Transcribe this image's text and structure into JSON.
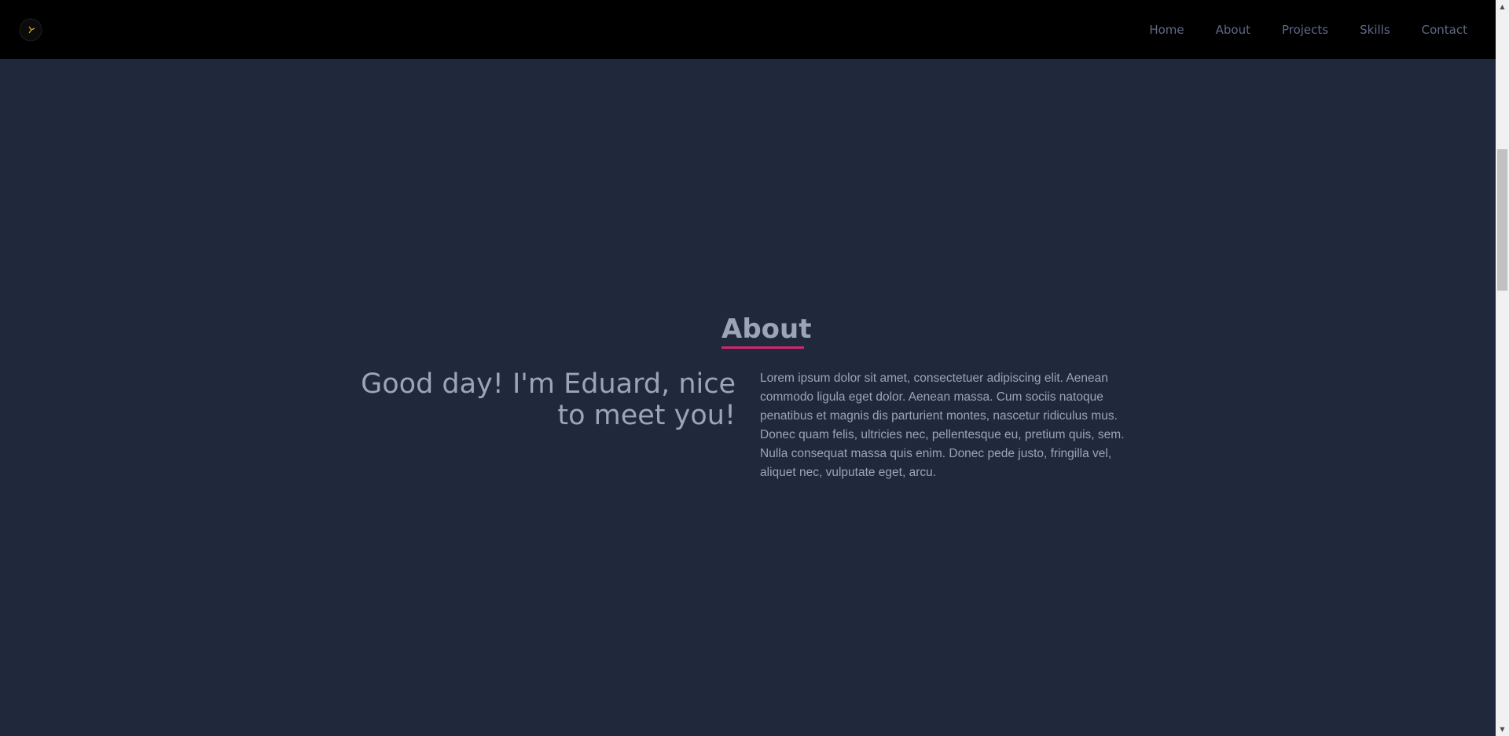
{
  "navbar": {
    "logo_icon": "moon-logo-icon",
    "links": [
      "Home",
      "About",
      "Projects",
      "Skills",
      "Contact"
    ]
  },
  "about": {
    "title": "About",
    "greeting": "Good day! I'm Eduard, nice to meet you!",
    "bio": "Lorem ipsum dolor sit amet, consectetuer adipiscing elit. Aenean commodo ligula eget dolor. Aenean massa. Cum sociis natoque penatibus et magnis dis parturient montes, nascetur ridiculus mus. Donec quam felis, ultricies nec, pellentesque eu, pretium quis, sem. Nulla consequat massa quis enim. Donec pede justo, fringilla vel, aliquet nec, vulputate eget, arcu."
  },
  "colors": {
    "background": "#20283b",
    "navbar": "#000000",
    "nav_text": "#5e6a86",
    "text": "#9aa5b8",
    "accent": "#d6246f",
    "logo": "#c9a227"
  },
  "scrollbar": {
    "up_icon": "scroll-up-arrow-icon",
    "down_icon": "scroll-down-arrow-icon"
  }
}
